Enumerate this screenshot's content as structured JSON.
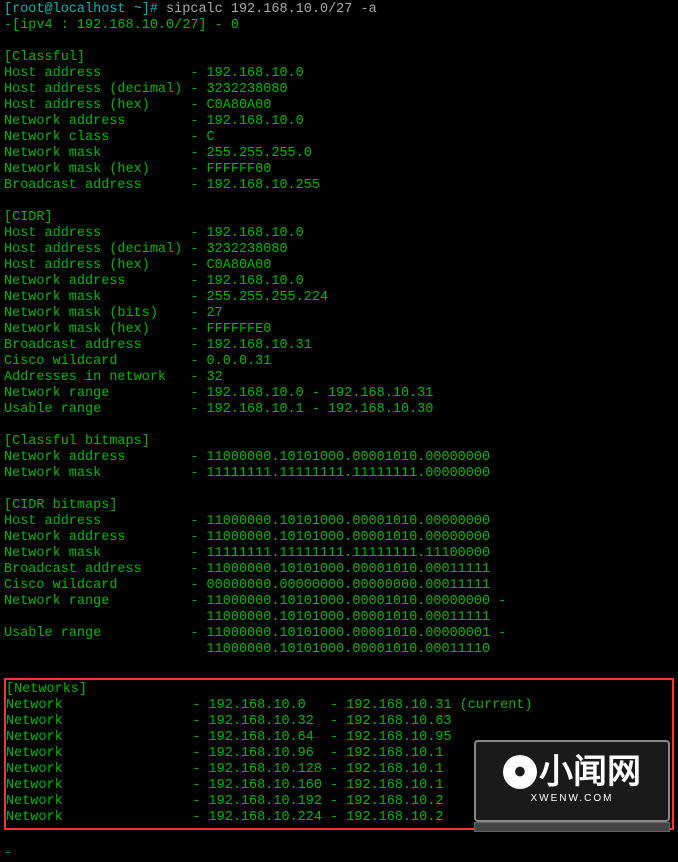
{
  "prompt": {
    "user_host": "[root@localhost ~]#",
    "command": "sipcalc 192.168.10.0/27 -a"
  },
  "header": "-[ipv4 : 192.168.10.0/27] - 0",
  "sections": {
    "classful": {
      "title": "[Classful]",
      "rows": [
        [
          "Host address",
          "192.168.10.0"
        ],
        [
          "Host address (decimal)",
          "3232238080"
        ],
        [
          "Host address (hex)",
          "C0A80A00"
        ],
        [
          "Network address",
          "192.168.10.0"
        ],
        [
          "Network class",
          "C"
        ],
        [
          "Network mask",
          "255.255.255.0"
        ],
        [
          "Network mask (hex)",
          "FFFFFF00"
        ],
        [
          "Broadcast address",
          "192.168.10.255"
        ]
      ]
    },
    "cidr": {
      "title": "[CIDR]",
      "rows": [
        [
          "Host address",
          "192.168.10.0"
        ],
        [
          "Host address (decimal)",
          "3232238080"
        ],
        [
          "Host address (hex)",
          "C0A80A00"
        ],
        [
          "Network address",
          "192.168.10.0"
        ],
        [
          "Network mask",
          "255.255.255.224"
        ],
        [
          "Network mask (bits)",
          "27"
        ],
        [
          "Network mask (hex)",
          "FFFFFFE0"
        ],
        [
          "Broadcast address",
          "192.168.10.31"
        ],
        [
          "Cisco wildcard",
          "0.0.0.31"
        ],
        [
          "Addresses in network",
          "32"
        ],
        [
          "Network range",
          "192.168.10.0 - 192.168.10.31"
        ],
        [
          "Usable range",
          "192.168.10.1 - 192.168.10.30"
        ]
      ]
    },
    "classful_bitmaps": {
      "title": "[Classful bitmaps]",
      "rows": [
        [
          "Network address",
          "11000000.10101000.00001010.00000000"
        ],
        [
          "Network mask",
          "11111111.11111111.11111111.00000000"
        ]
      ]
    },
    "cidr_bitmaps": {
      "title": "[CIDR bitmaps]",
      "rows": [
        [
          "Host address",
          "11000000.10101000.00001010.00000000"
        ],
        [
          "Network address",
          "11000000.10101000.00001010.00000000"
        ],
        [
          "Network mask",
          "11111111.11111111.11111111.11100000"
        ],
        [
          "Broadcast address",
          "11000000.10101000.00001010.00011111"
        ],
        [
          "Cisco wildcard",
          "00000000.00000000.00000000.00011111"
        ],
        [
          "Network range",
          "11000000.10101000.00001010.00000000 -"
        ],
        [
          "",
          "11000000.10101000.00001010.00011111"
        ],
        [
          "Usable range",
          "11000000.10101000.00001010.00000001 -"
        ],
        [
          "",
          "11000000.10101000.00001010.00011110"
        ]
      ]
    },
    "networks": {
      "title": "[Networks]",
      "rows": [
        [
          "Network",
          "192.168.10.0   - 192.168.10.31 (current)"
        ],
        [
          "Network",
          "192.168.10.32  - 192.168.10.63"
        ],
        [
          "Network",
          "192.168.10.64  - 192.168.10.95"
        ],
        [
          "Network",
          "192.168.10.96  - 192.168.10.1"
        ],
        [
          "Network",
          "192.168.10.128 - 192.168.10.1"
        ],
        [
          "Network",
          "192.168.10.160 - 192.168.10.1"
        ],
        [
          "Network",
          "192.168.10.192 - 192.168.10.2"
        ],
        [
          "Network",
          "192.168.10.224 - 192.168.10.2"
        ]
      ]
    }
  },
  "watermark": {
    "main": "小闻网",
    "sub": "XWENW.COM"
  }
}
